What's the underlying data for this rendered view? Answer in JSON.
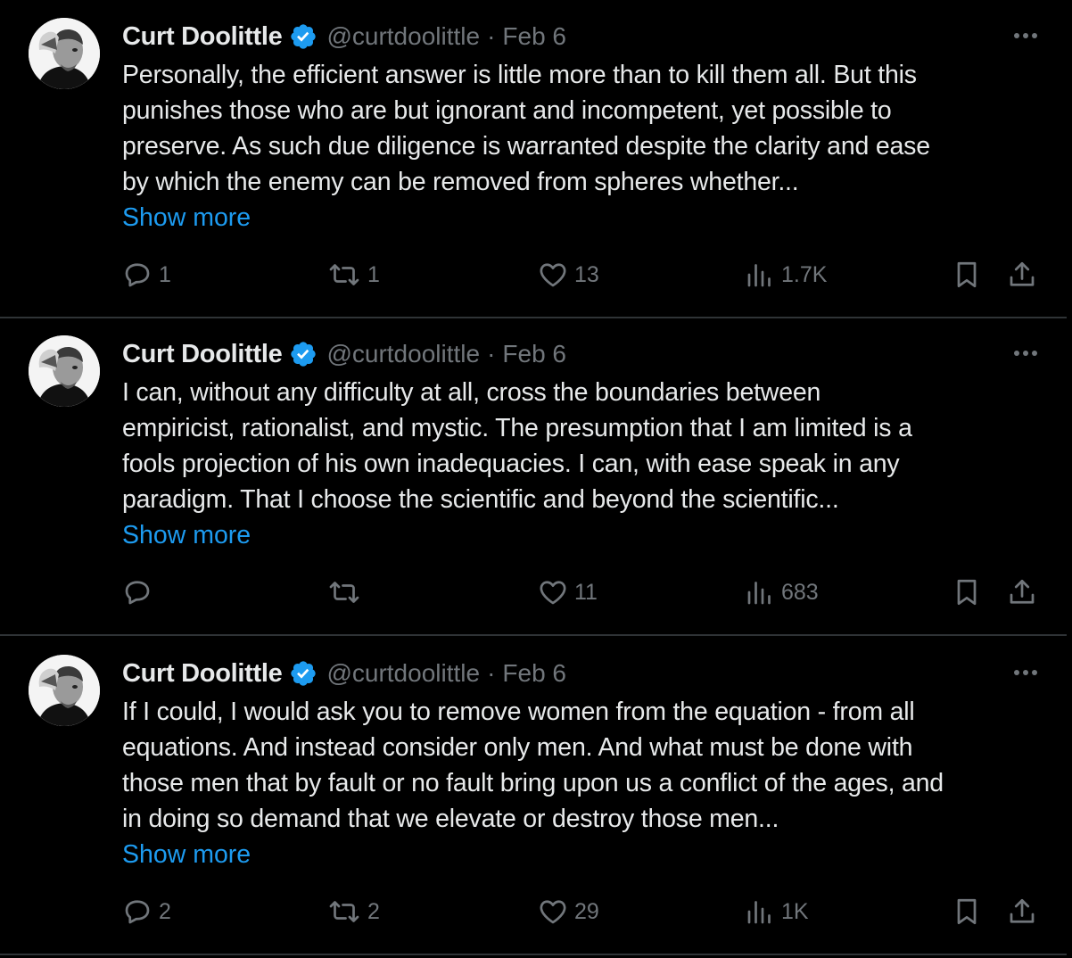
{
  "tweets": [
    {
      "name": "Curt Doolittle",
      "handle": "@curtdoolittle",
      "separator": "·",
      "date": "Feb 6",
      "lines": [
        "Personally, the efficient answer is little more than to kill them all. But this",
        "punishes those who are but ignorant and incompetent, yet possible to",
        "preserve. As such due diligence is warranted despite the clarity and ease",
        "by which the enemy can be removed from spheres whether..."
      ],
      "show_more": "Show more",
      "replies": "1",
      "reposts": "1",
      "likes": "13",
      "views": "1.7K"
    },
    {
      "name": "Curt Doolittle",
      "handle": "@curtdoolittle",
      "separator": "·",
      "date": "Feb 6",
      "lines": [
        "I can, without any difficulty at all, cross the boundaries between",
        "empiricist, rationalist, and mystic. The presumption that I am limited is a",
        "fools projection of his own inadequacies. I can, with ease speak in any",
        "paradigm. That I choose the scientific and beyond the scientific..."
      ],
      "show_more": "Show more",
      "replies": "",
      "reposts": "",
      "likes": "11",
      "views": "683"
    },
    {
      "name": "Curt Doolittle",
      "handle": "@curtdoolittle",
      "separator": "·",
      "date": "Feb 6",
      "lines": [
        "If I could, I would ask you to remove women from the equation - from all",
        "equations. And instead consider only  men. And what must be done with",
        "those men that by fault or no fault bring upon us a conflict of the ages, and",
        "in doing so demand that we elevate or destroy those men..."
      ],
      "show_more": "Show more",
      "replies": "2",
      "reposts": "2",
      "likes": "29",
      "views": "1K"
    }
  ],
  "icons": {
    "verified": "verified-badge-icon",
    "more": "more-dots-icon",
    "reply": "reply-icon",
    "repost": "repost-icon",
    "like": "like-heart-icon",
    "views": "views-chart-icon",
    "bookmark": "bookmark-icon",
    "share": "share-icon"
  },
  "colors": {
    "background": "#000000",
    "text": "#e7e9ea",
    "muted": "#71767b",
    "link": "#1d9bf0",
    "verified": "#1d9bf0",
    "divider": "#2f3336"
  }
}
